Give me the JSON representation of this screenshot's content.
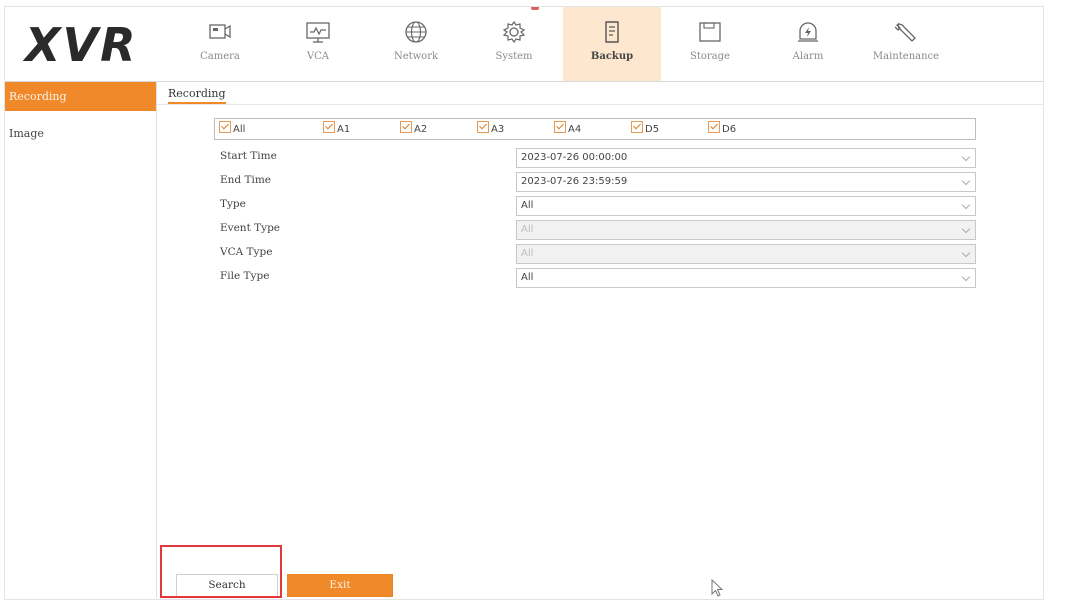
{
  "logo": "XVR",
  "nav": {
    "tabs": [
      {
        "label": "Camera",
        "icon": "camera-icon",
        "active": false
      },
      {
        "label": "VCA",
        "icon": "vca-monitor-icon",
        "active": false
      },
      {
        "label": "Network",
        "icon": "globe-icon",
        "active": false
      },
      {
        "label": "System",
        "icon": "gear-icon",
        "active": false
      },
      {
        "label": "Backup",
        "icon": "backup-document-icon",
        "active": true
      },
      {
        "label": "Storage",
        "icon": "storage-drive-icon",
        "active": false
      },
      {
        "label": "Alarm",
        "icon": "alarm-lightning-icon",
        "active": false
      },
      {
        "label": "Maintenance",
        "icon": "wrench-icon",
        "active": false
      }
    ]
  },
  "sidebar": {
    "items": [
      {
        "label": "Recording",
        "active": true
      },
      {
        "label": "Image",
        "active": false
      }
    ]
  },
  "subtab": {
    "label": "Recording"
  },
  "channels": [
    {
      "label": "All",
      "checked": true
    },
    {
      "label": "A1",
      "checked": true
    },
    {
      "label": "A2",
      "checked": true
    },
    {
      "label": "A3",
      "checked": true
    },
    {
      "label": "A4",
      "checked": true
    },
    {
      "label": "D5",
      "checked": true
    },
    {
      "label": "D6",
      "checked": true
    }
  ],
  "form": {
    "start_time": {
      "label": "Start Time",
      "value": "2023-07-26 00:00:00"
    },
    "end_time": {
      "label": "End Time",
      "value": "2023-07-26 23:59:59"
    },
    "type": {
      "label": "Type",
      "value": "All"
    },
    "event_type": {
      "label": "Event Type",
      "value": "All",
      "disabled": true
    },
    "vca_type": {
      "label": "VCA Type",
      "value": "All",
      "disabled": true
    },
    "file_type": {
      "label": "File Type",
      "value": "All"
    }
  },
  "buttons": {
    "search": "Search",
    "exit": "Exit"
  },
  "colors": {
    "accent": "#f0892a",
    "active_tab_bg": "#fde8cf",
    "highlight": "#e0383b"
  }
}
